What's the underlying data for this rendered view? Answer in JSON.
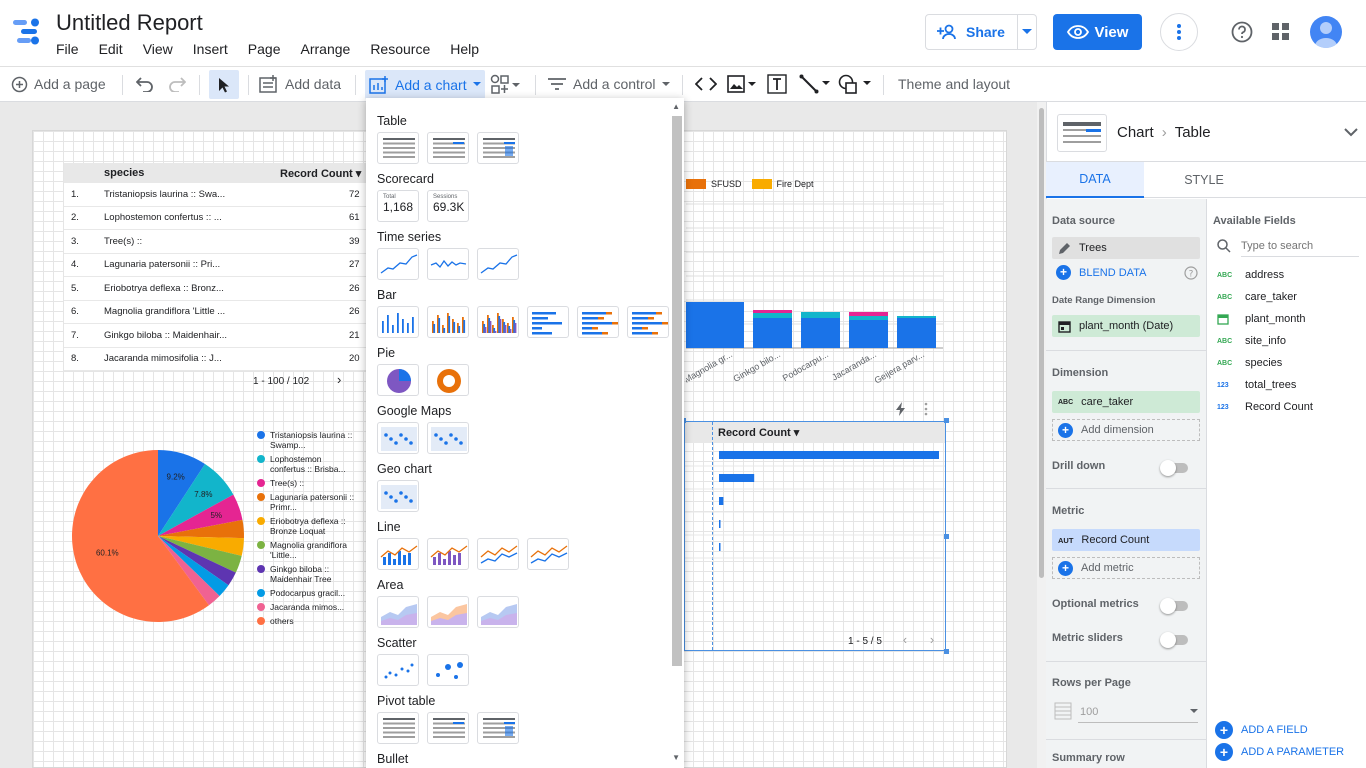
{
  "header": {
    "title": "Untitled Report",
    "menu": [
      "File",
      "Edit",
      "View",
      "Insert",
      "Page",
      "Arrange",
      "Resource",
      "Help"
    ],
    "share_label": "Share",
    "view_label": "View"
  },
  "toolbar": {
    "add_page": "Add a page",
    "add_data": "Add data",
    "add_chart": "Add a chart",
    "add_control": "Add a control",
    "theme": "Theme and layout"
  },
  "species_table": {
    "col_species": "species",
    "col_count": "Record Count",
    "rows": [
      {
        "n": "1.",
        "name": "Tristaniopsis laurina :: Swa...",
        "val": "72"
      },
      {
        "n": "2.",
        "name": "Lophostemon confertus :: ...",
        "val": "61"
      },
      {
        "n": "3.",
        "name": "Tree(s) ::",
        "val": "39"
      },
      {
        "n": "4.",
        "name": "Lagunaria patersonii :: Pri...",
        "val": "27"
      },
      {
        "n": "5.",
        "name": "Eriobotrya deflexa :: Bronz...",
        "val": "26"
      },
      {
        "n": "6.",
        "name": "Magnolia grandiflora 'Little ...",
        "val": "26"
      },
      {
        "n": "7.",
        "name": "Ginkgo biloba :: Maidenhair...",
        "val": "21"
      },
      {
        "n": "8.",
        "name": "Jacaranda mimosifolia :: J...",
        "val": "20"
      }
    ],
    "pager": "1 - 100 / 102"
  },
  "pie": {
    "slices": [
      {
        "label": "Tristaniopsis laurina :: Swamp...",
        "color": "#1a73e8",
        "pct": 9.2,
        "text": "9.2%"
      },
      {
        "label": "Lophostemon confertus :: Brisba...",
        "color": "#12b5cb",
        "pct": 7.8,
        "text": "7.8%"
      },
      {
        "label": "Tree(s) ::",
        "color": "#e52592",
        "pct": 5.0,
        "text": "5%"
      },
      {
        "label": "Lagunaria patersonii :: Primr...",
        "color": "#e8710a",
        "pct": 3.4,
        "text": ""
      },
      {
        "label": "Eriobotrya deflexa :: Bronze Loquat",
        "color": "#f9ab00",
        "pct": 3.3,
        "text": ""
      },
      {
        "label": "Magnolia grandiflora 'Little...",
        "color": "#7cb342",
        "pct": 3.3,
        "text": ""
      },
      {
        "label": "Ginkgo biloba :: Maidenhair Tree",
        "color": "#5e35b1",
        "pct": 2.7,
        "text": ""
      },
      {
        "label": "Podocarpus gracil...",
        "color": "#039be5",
        "pct": 2.6,
        "text": ""
      },
      {
        "label": "Jacaranda mimos...",
        "color": "#f06292",
        "pct": 2.6,
        "text": ""
      },
      {
        "label": "others",
        "color": "#ff7043",
        "pct": 60.1,
        "text": "60.1%"
      }
    ]
  },
  "bar_chart": {
    "legend": [
      {
        "name": "SFUSD",
        "color": "#e8710a"
      },
      {
        "name": "Fire Dept",
        "color": "#f9ab00"
      }
    ],
    "bars": [
      {
        "label": "",
        "segments": [
          {
            "color": "#1a73e8",
            "h": 46
          }
        ]
      },
      {
        "label": "Magnolia gr...",
        "segments": [
          {
            "color": "#1a73e8",
            "h": 46
          }
        ]
      },
      {
        "label": "Ginkgo bilo...",
        "segments": [
          {
            "color": "#1a73e8",
            "h": 30
          },
          {
            "color": "#12b5cb",
            "h": 5
          },
          {
            "color": "#e52592",
            "h": 3
          }
        ]
      },
      {
        "label": "Podocarpu...",
        "segments": [
          {
            "color": "#1a73e8",
            "h": 30
          },
          {
            "color": "#12b5cb",
            "h": 6
          }
        ]
      },
      {
        "label": "Jacaranda...",
        "segments": [
          {
            "color": "#1a73e8",
            "h": 28
          },
          {
            "color": "#12b5cb",
            "h": 4
          },
          {
            "color": "#e52592",
            "h": 4
          }
        ]
      },
      {
        "label": "Geijera parv...",
        "segments": [
          {
            "color": "#1a73e8",
            "h": 30
          },
          {
            "color": "#12b5cb",
            "h": 2
          }
        ]
      }
    ]
  },
  "rc_table": {
    "col": "Record Count",
    "bars": [
      1.0,
      0.16,
      0.02,
      0.005,
      0.005
    ],
    "pager": "1 - 5 / 5"
  },
  "chart_menu": {
    "sections": [
      "Table",
      "Scorecard",
      "Time series",
      "Bar",
      "Pie",
      "Google Maps",
      "Geo chart",
      "Line",
      "Area",
      "Scatter",
      "Pivot table",
      "Bullet"
    ],
    "scorecard1_label": "Total",
    "scorecard1_value": "1,168",
    "scorecard2_label": "Sessions",
    "scorecard2_value": "69.3K"
  },
  "panel": {
    "crumb_chart": "Chart",
    "crumb_type": "Table",
    "tab_data": "DATA",
    "tab_style": "STYLE",
    "data_source_label": "Data source",
    "data_source": "Trees",
    "blend": "BLEND DATA",
    "date_range_label": "Date Range Dimension",
    "date_range": "plant_month (Date)",
    "dimension_label": "Dimension",
    "dimension": "care_taker",
    "add_dimension": "Add dimension",
    "drill_down": "Drill down",
    "metric_label": "Metric",
    "metric_type": "AUT",
    "metric": "Record Count",
    "add_metric": "Add metric",
    "optional_metrics": "Optional metrics",
    "metric_sliders": "Metric sliders",
    "rows_per_page_label": "Rows per Page",
    "rows_per_page": "100",
    "summary_row": "Summary row",
    "available_fields": "Available Fields",
    "search_placeholder": "Type to search",
    "fields": [
      {
        "type": "ABC",
        "name": "address"
      },
      {
        "type": "ABC",
        "name": "care_taker"
      },
      {
        "type": "DATE",
        "name": "plant_month"
      },
      {
        "type": "ABC",
        "name": "site_info"
      },
      {
        "type": "ABC",
        "name": "species"
      },
      {
        "type": "123",
        "name": "total_trees"
      },
      {
        "type": "123",
        "name": "Record Count"
      }
    ],
    "add_field": "ADD A FIELD",
    "add_parameter": "ADD A PARAMETER"
  }
}
